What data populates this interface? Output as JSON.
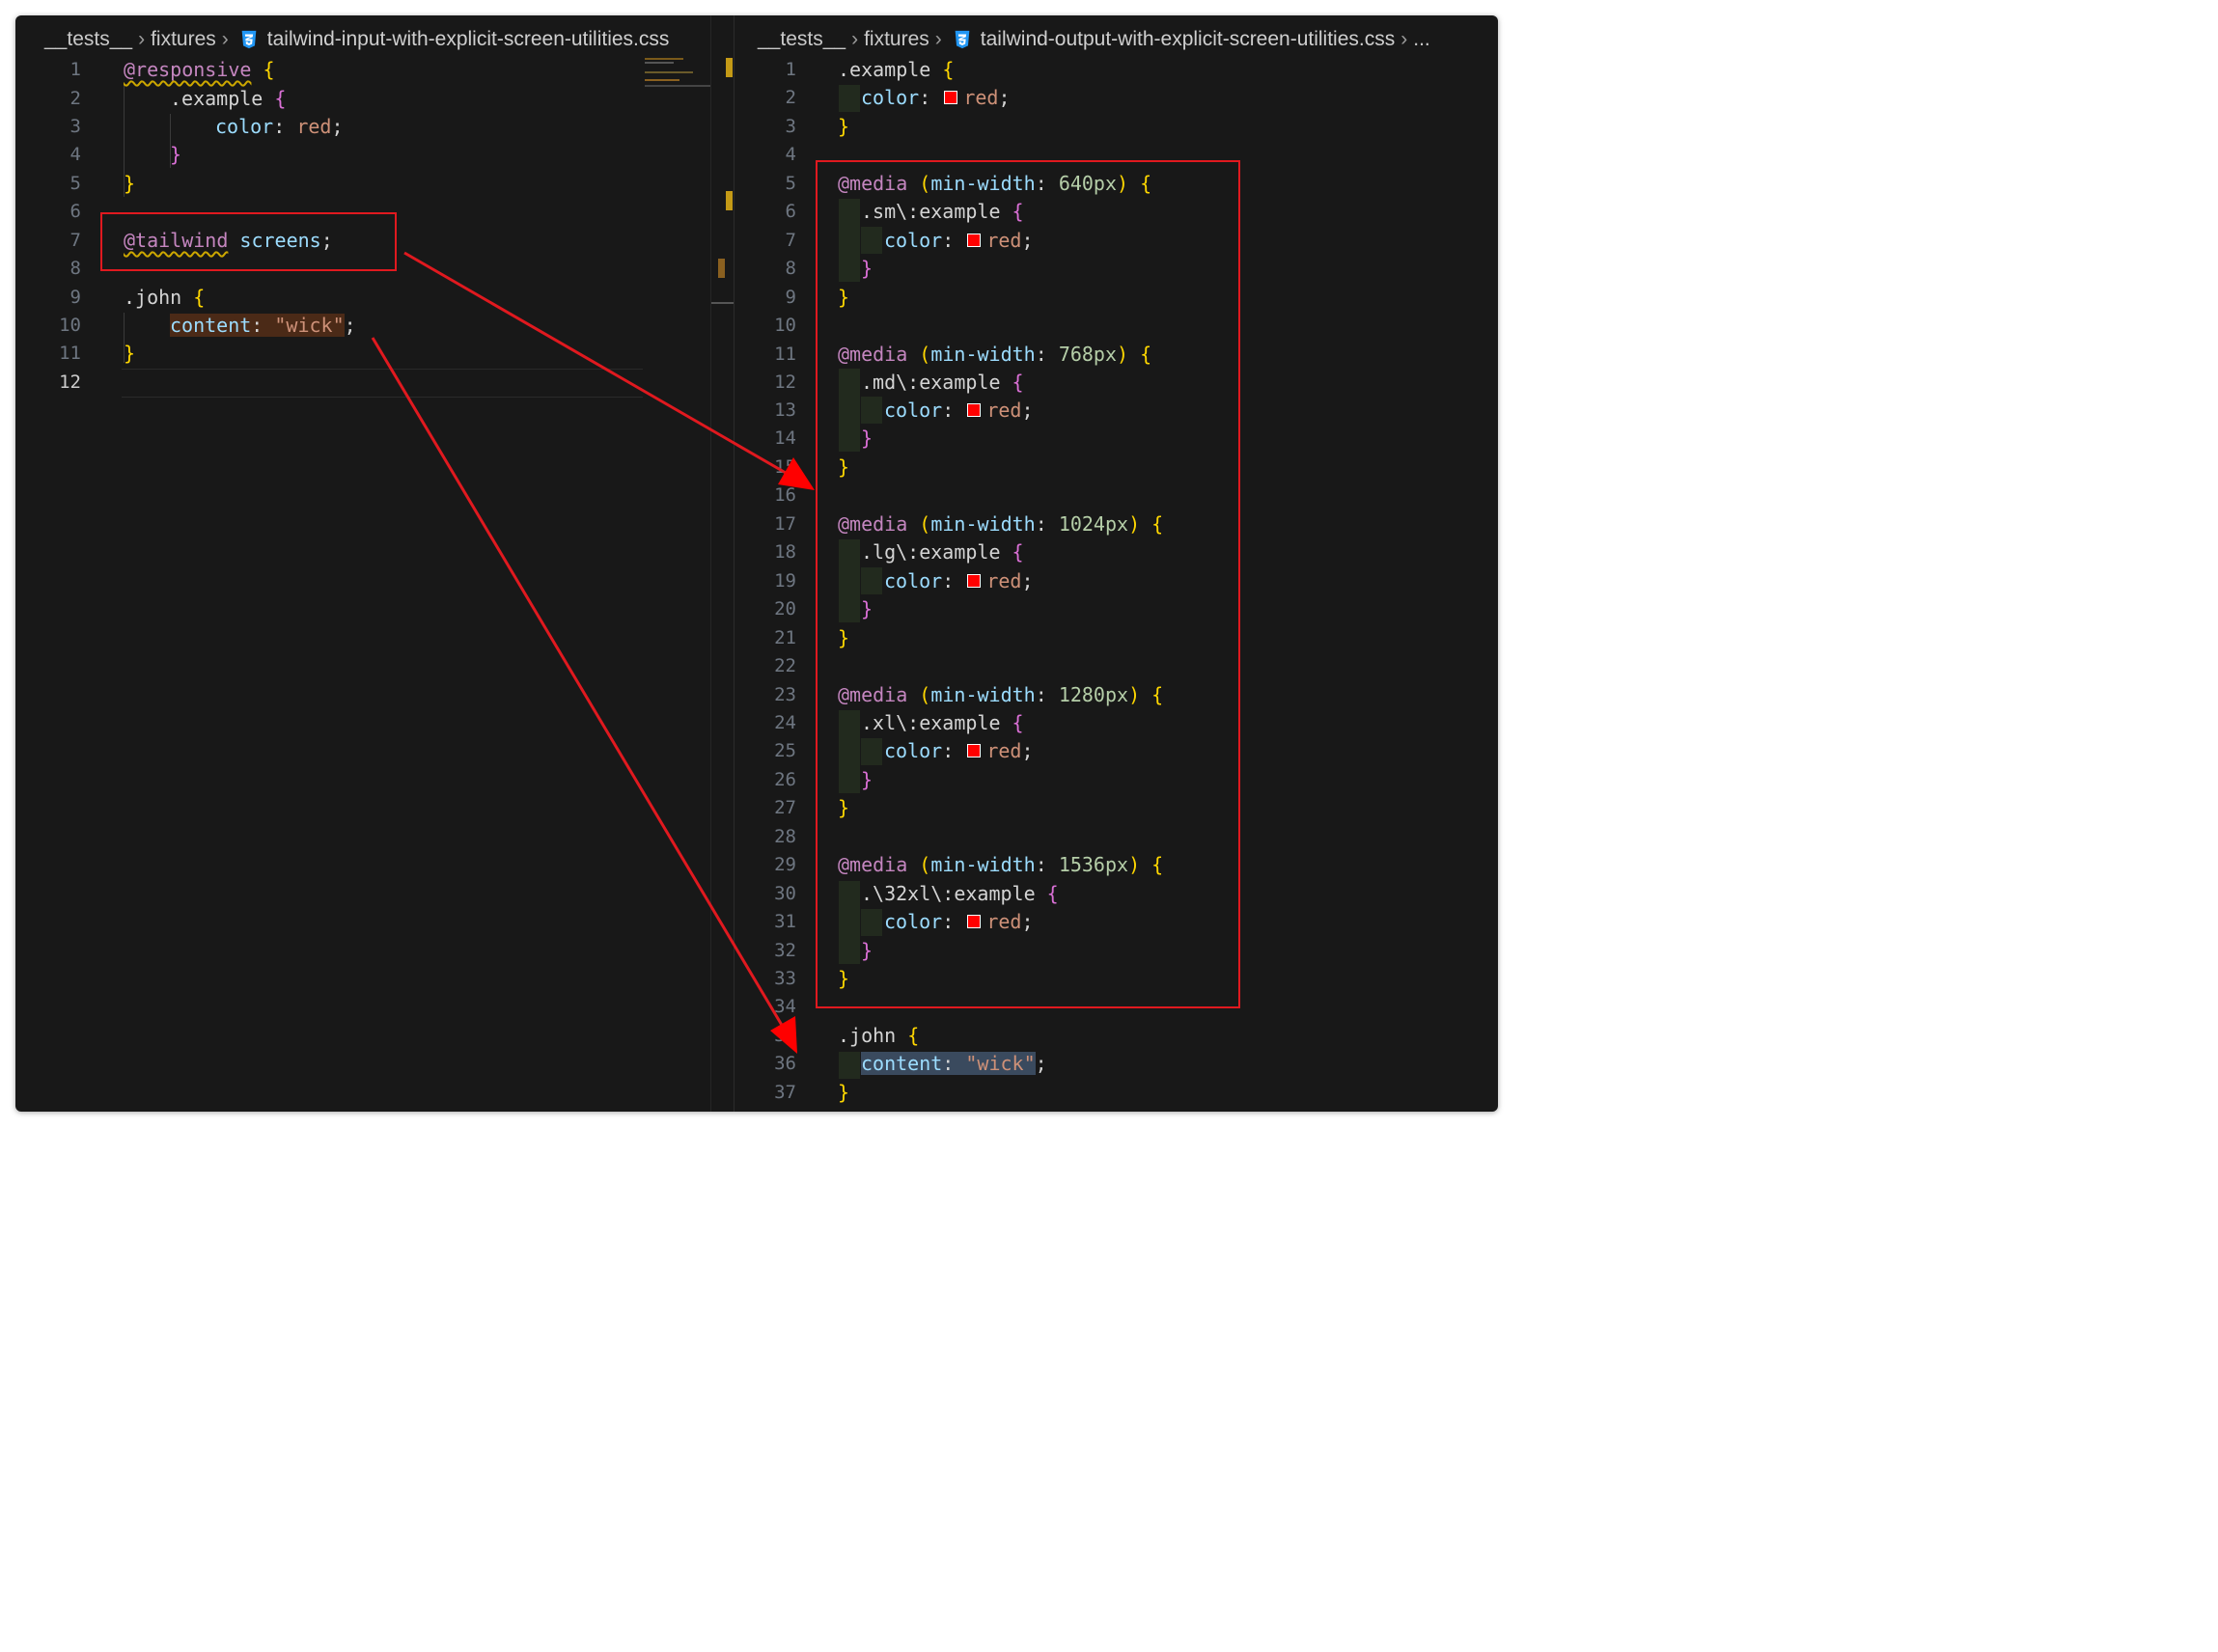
{
  "left_editor": {
    "breadcrumb": {
      "folder1": "__tests__",
      "folder2": "fixtures",
      "file": "tailwind-input-with-explicit-screen-utilities.css",
      "file_icon": "css3-icon"
    },
    "line_numbers": [
      "1",
      "2",
      "3",
      "4",
      "5",
      "6",
      "7",
      "8",
      "9",
      "10",
      "11",
      "12"
    ],
    "code": {
      "responsive_at": "@responsive",
      "brace_open": "{",
      "brace_close": "}",
      "example_sel": ".example",
      "color_prop": "color",
      "colon": ":",
      "red_val": "red",
      "semi": ";",
      "tailwind_at": "@tailwind",
      "screens_word": "screens",
      "john_sel": ".john",
      "content_prop": "content",
      "wick_str": "\"wick\""
    }
  },
  "right_editor": {
    "breadcrumb": {
      "folder1": "__tests__",
      "folder2": "fixtures",
      "file": "tailwind-output-with-explicit-screen-utilities.css",
      "more": "...",
      "file_icon": "css3-icon"
    },
    "line_numbers": [
      "1",
      "2",
      "3",
      "4",
      "5",
      "6",
      "7",
      "8",
      "9",
      "10",
      "11",
      "12",
      "13",
      "14",
      "15",
      "16",
      "17",
      "18",
      "19",
      "20",
      "21",
      "22",
      "23",
      "24",
      "25",
      "26",
      "27",
      "28",
      "29",
      "30",
      "31",
      "32",
      "33",
      "34",
      "35",
      "36",
      "37"
    ],
    "code": {
      "example_sel": ".example",
      "color_prop": "color",
      "colon": ":",
      "red_val": "red",
      "semi": ";",
      "brace_open": "{",
      "brace_close": "}",
      "media_at": "@media",
      "paren_open": "(",
      "paren_close": ")",
      "min_width": "min-width",
      "bp_sm": "640px",
      "bp_md": "768px",
      "bp_lg": "1024px",
      "bp_xl": "1280px",
      "bp_2xl": "1536px",
      "sel_sm": ".sm\\:example",
      "sel_md": ".md\\:example",
      "sel_lg": ".lg\\:example",
      "sel_xl": ".xl\\:example",
      "sel_2xl": ".\\32xl\\:example",
      "john_sel": ".john",
      "content_prop": "content",
      "wick_str": "\"wick\""
    }
  },
  "colors": {
    "background": "#181818",
    "annotation_red": "#e0191f",
    "swatch_red": "#ff0000"
  }
}
